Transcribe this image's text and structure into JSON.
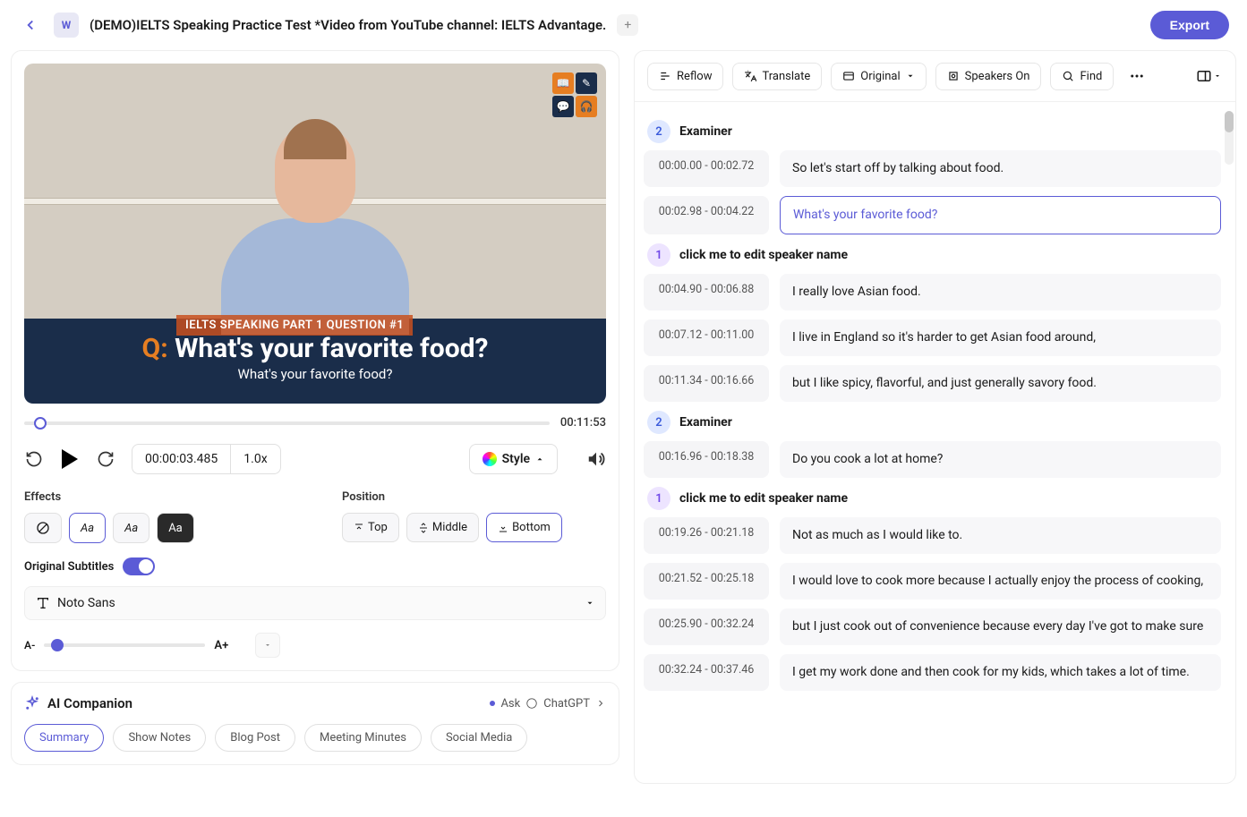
{
  "header": {
    "title": "(DEMO)IELTS Speaking Practice Test *Video from YouTube channel: IELTS Advantage.",
    "export": "Export"
  },
  "video": {
    "caption_tag": "IELTS SPEAKING PART 1 QUESTION #1",
    "question_prefix": "Q: ",
    "question": "What's your favorite food?",
    "subtitle": "What's your favorite food?",
    "duration": "00:11:53",
    "current_time": "00:00:03.485",
    "speed": "1.0x"
  },
  "styling": {
    "effects_label": "Effects",
    "position_label": "Position",
    "pos_top": "Top",
    "pos_middle": "Middle",
    "pos_bottom": "Bottom",
    "orig_subtitles": "Original Subtitles",
    "font": "Noto Sans",
    "size_minus": "A-",
    "size_plus": "A+",
    "style_btn": "Style"
  },
  "ai": {
    "title": "AI Companion",
    "ask": "Ask",
    "provider": "ChatGPT",
    "tabs": [
      "Summary",
      "Show Notes",
      "Blog Post",
      "Meeting Minutes",
      "Social Media"
    ]
  },
  "toolbar": {
    "reflow": "Reflow",
    "translate": "Translate",
    "original": "Original",
    "speakers": "Speakers On",
    "find": "Find"
  },
  "transcript": [
    {
      "speaker_id": "2",
      "speaker_name": "Examiner",
      "speaker_class": "blue",
      "lines": [
        {
          "t": "00:00.00 - 00:02.72",
          "txt": "So let's start off by talking about food.",
          "active": false
        },
        {
          "t": "00:02.98 - 00:04.22",
          "txt": "What's your favorite food?",
          "active": true
        }
      ]
    },
    {
      "speaker_id": "1",
      "speaker_name": "click me to edit speaker name",
      "speaker_class": "purple",
      "lines": [
        {
          "t": "00:04.90 - 00:06.88",
          "txt": "I really love Asian food.",
          "active": false
        },
        {
          "t": "00:07.12  -  00:11.00",
          "txt": "I live in England so it's harder to get Asian food around,",
          "active": false
        },
        {
          "t": "00:11.34  -  00:16.66",
          "txt": "but I like spicy, flavorful, and just generally savory food.",
          "active": false
        }
      ]
    },
    {
      "speaker_id": "2",
      "speaker_name": "Examiner",
      "speaker_class": "blue",
      "lines": [
        {
          "t": "00:16.96  -  00:18.38",
          "txt": "Do you cook a lot at home?",
          "active": false
        }
      ]
    },
    {
      "speaker_id": "1",
      "speaker_name": "click me to edit speaker name",
      "speaker_class": "purple",
      "lines": [
        {
          "t": "00:19.26  -  00:21.18",
          "txt": "Not as much as I would like to.",
          "active": false
        },
        {
          "t": "00:21.52  -  00:25.18",
          "txt": "I would love to cook more because I actually enjoy the process of cooking,",
          "active": false
        },
        {
          "t": "00:25.90 - 00:32.24",
          "txt": "but I just cook out of convenience because every day I've got to make sure",
          "active": false
        },
        {
          "t": "00:32.24 - 00:37.46",
          "txt": "I get my work done and then cook for my kids, which takes a lot of time.",
          "active": false
        }
      ]
    }
  ]
}
